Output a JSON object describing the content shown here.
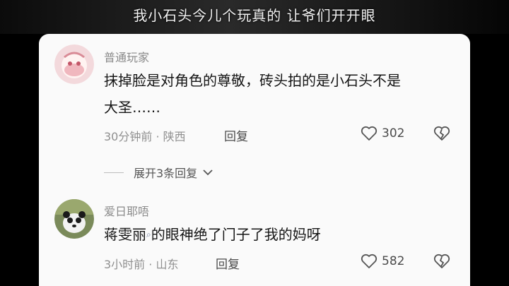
{
  "video": {
    "subtitle": "我小石头今儿个玩真的   让爷们开开眼"
  },
  "comments": [
    {
      "username": "普通玩家",
      "text_line1": "抹掉脸是对角色的尊敬，砖头拍的是小石头不是",
      "text_line2": "大圣……",
      "time_location": "30分钟前 · 陕西",
      "reply_label": "回复",
      "likes": "302",
      "expand_label": "展开3条回复"
    },
    {
      "username": "爱日耶唔",
      "text_before_link": "蒋雯丽",
      "text_after_link": "的眼神绝了门子了我的妈呀",
      "time_location": "3小时前 · 山东",
      "reply_label": "回复",
      "likes": "582"
    }
  ],
  "icons": {
    "like": "heart-outline-icon",
    "dislike": "broken-heart-icon",
    "expand": "chevron-down-icon",
    "search": "search-icon"
  }
}
